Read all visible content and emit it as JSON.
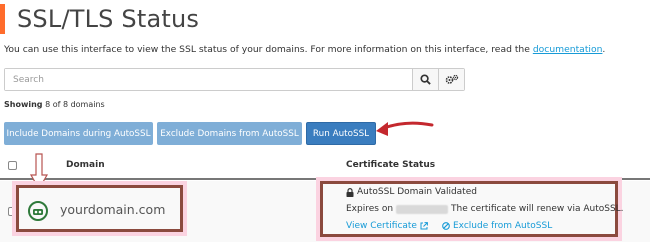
{
  "page": {
    "title": "SSL/TLS Status",
    "description_prefix": "You can use this interface to view the SSL status of your domains. For more information on this interface, read the ",
    "description_link": "documentation",
    "description_suffix": "."
  },
  "search": {
    "placeholder": "Search"
  },
  "showing": {
    "label": "Showing",
    "count": "8 of 8 domains"
  },
  "toolbar": {
    "include_label": "Include Domains during AutoSSL",
    "exclude_label": "Exclude Domains from AutoSSL",
    "run_label": "Run AutoSSL"
  },
  "table": {
    "headers": {
      "domain": "Domain",
      "status": "Certificate Status"
    },
    "rows": [
      {
        "domain": "yourdomain.com",
        "status_title": "AutoSSL Domain Validated",
        "expires_prefix": "Expires on",
        "expires_suffix": "The certificate will renew via AutoSSL.",
        "view_cert_label": "View Certificate",
        "exclude_label": "Exclude from AutoSSL"
      }
    ]
  },
  "colors": {
    "accent": "#ff6c2c",
    "button": "#7faed7",
    "button_primary": "#3a7dbf",
    "link": "#179bd7",
    "valid_green": "#2f7a3b",
    "annotation": "#8b4a3e",
    "annotation_glow": "#fbd3e1"
  },
  "icons": [
    "search-icon",
    "gear-icon",
    "lock-icon",
    "external-link-icon",
    "ban-icon"
  ]
}
